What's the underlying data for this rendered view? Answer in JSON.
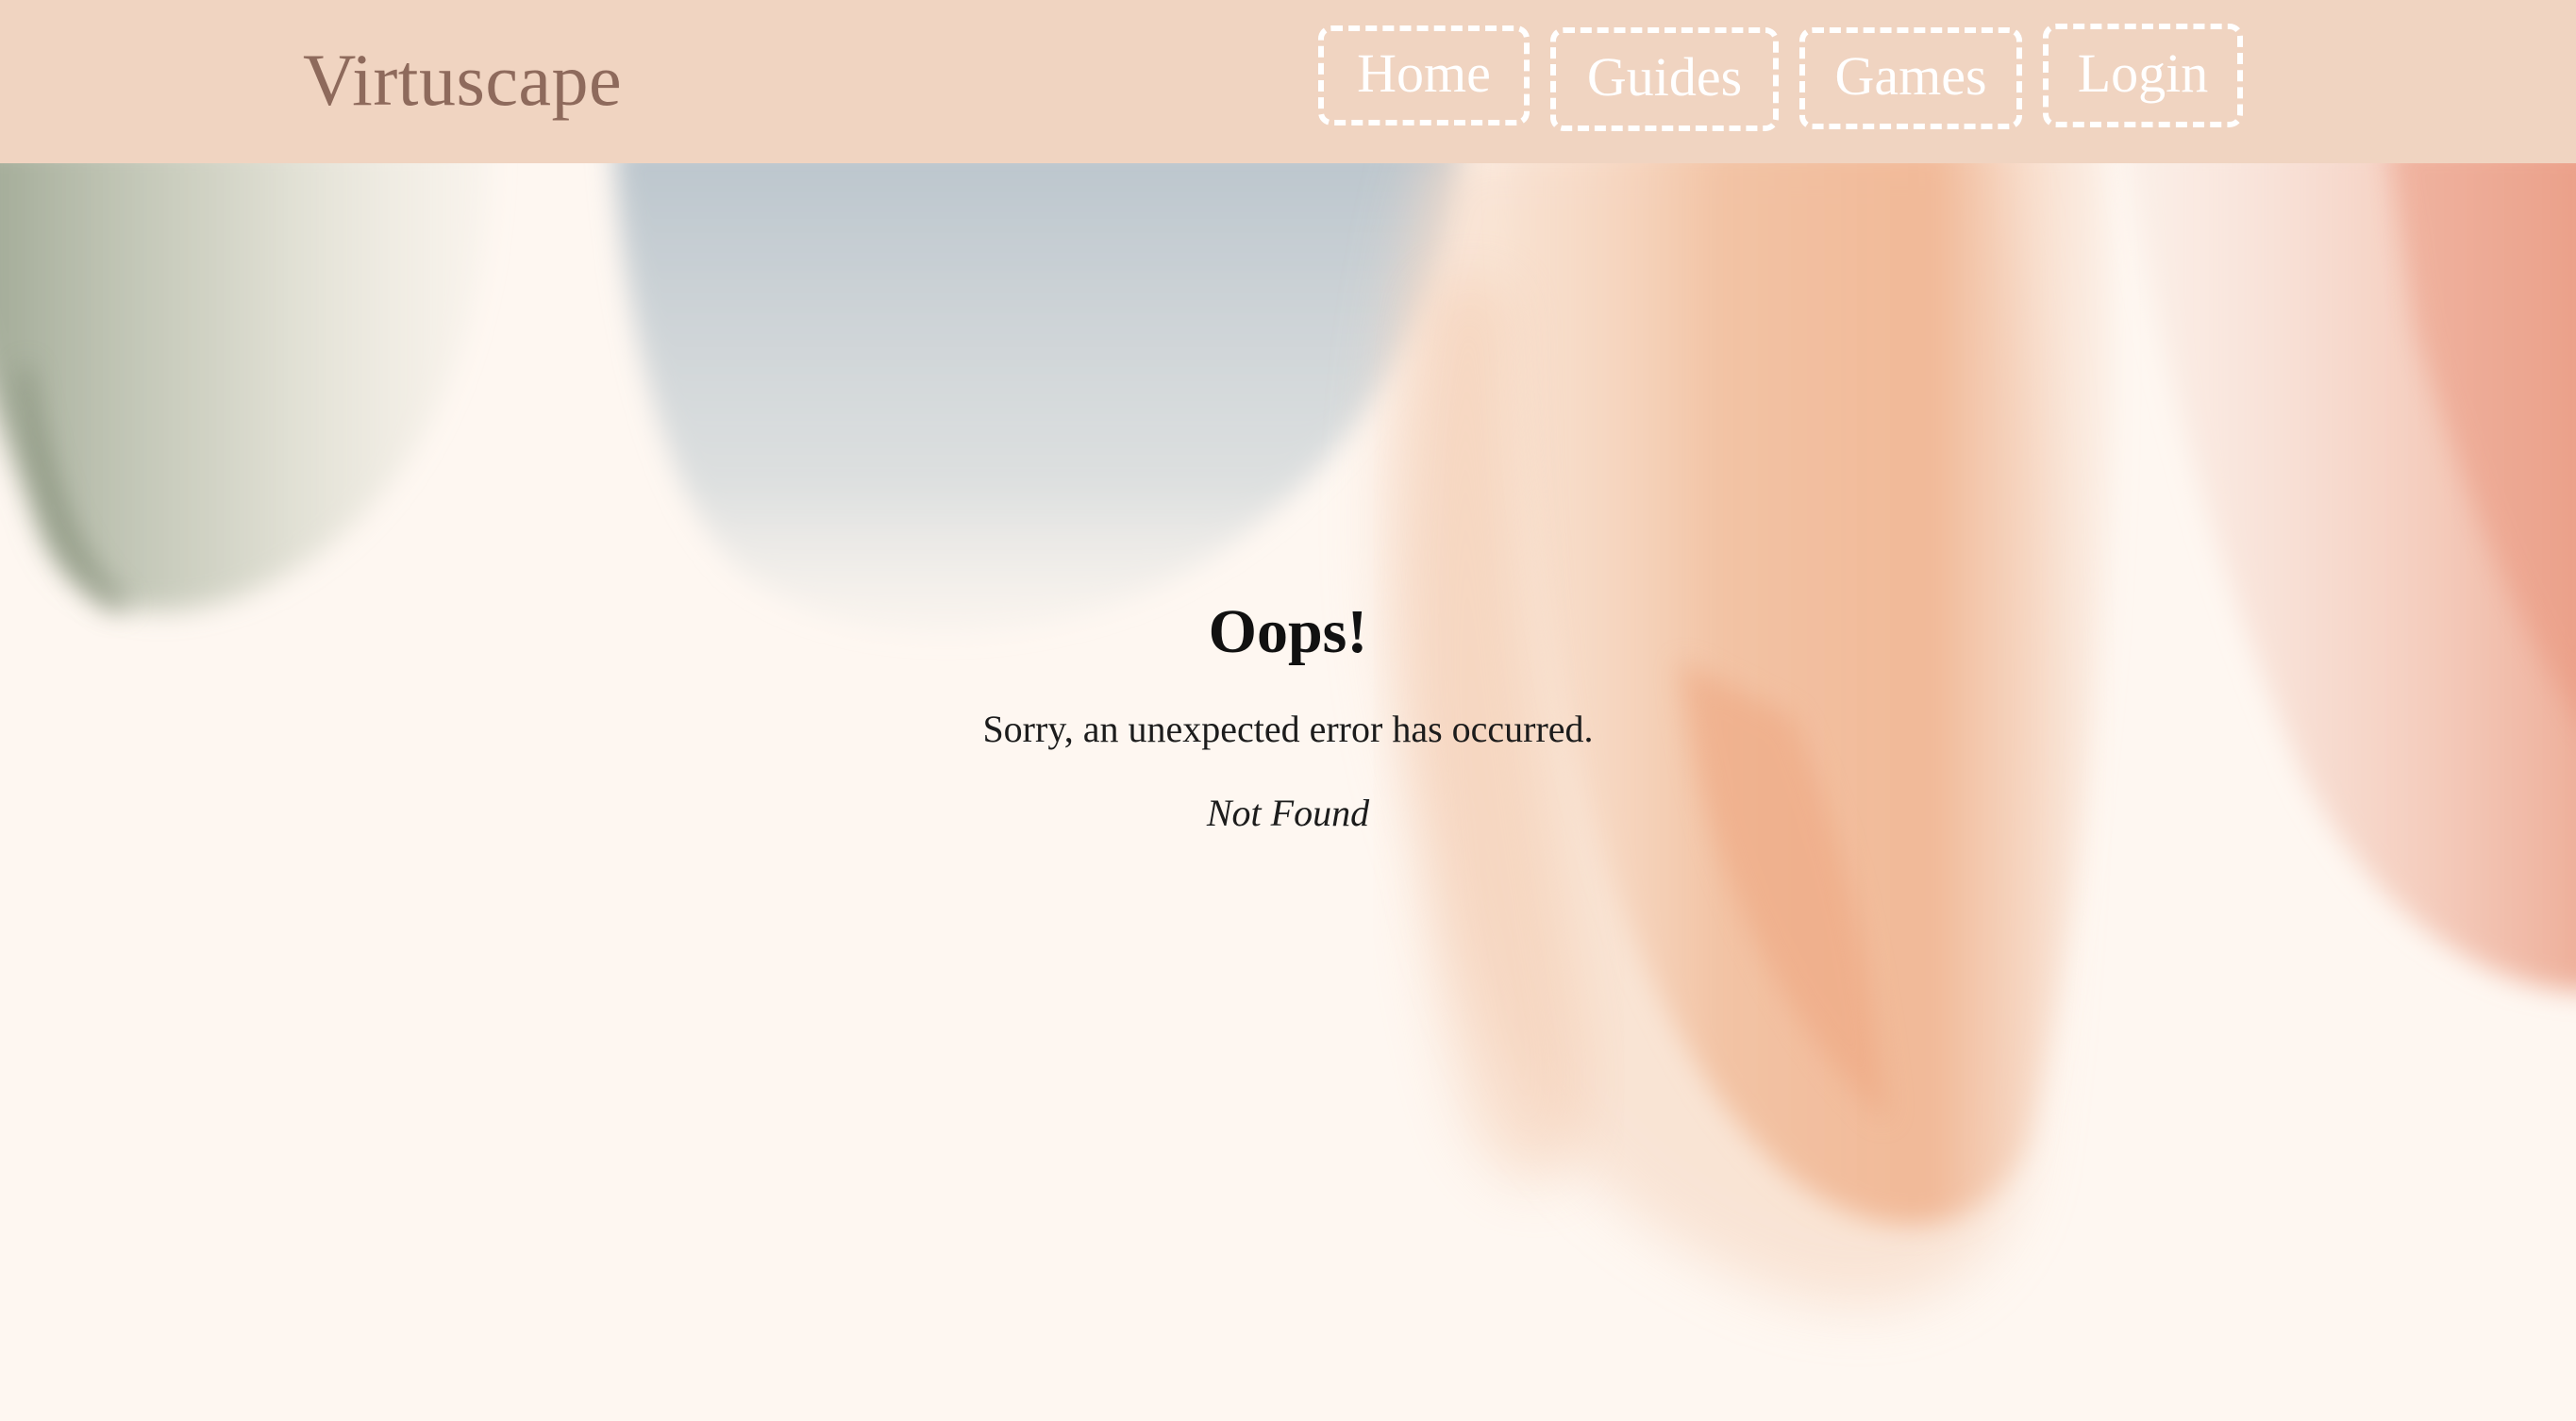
{
  "header": {
    "brand": "Virtuscape",
    "nav": {
      "home": "Home",
      "guides": "Guides",
      "games": "Games",
      "login": "Login"
    }
  },
  "error": {
    "title": "Oops!",
    "message": "Sorry, an unexpected error has occurred.",
    "status_text": "Not Found"
  },
  "colors": {
    "header_bg": "#f0d4c1",
    "brand_text": "#8e6a5c",
    "page_bg": "#fef7f1",
    "nav_border": "#ffffff"
  }
}
